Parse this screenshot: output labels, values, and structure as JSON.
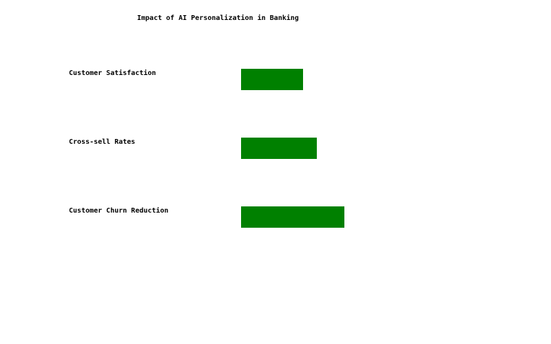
{
  "chart_data": {
    "type": "bar",
    "orientation": "horizontal",
    "title": "Impact of AI Personalization in Banking",
    "categories": [
      "Customer Satisfaction",
      "Cross-sell Rates",
      "Customer Churn Reduction"
    ],
    "values": [
      18,
      22,
      30
    ],
    "xlim": [
      0,
      100
    ],
    "grid": false,
    "legend": "none",
    "color": "#008000"
  }
}
